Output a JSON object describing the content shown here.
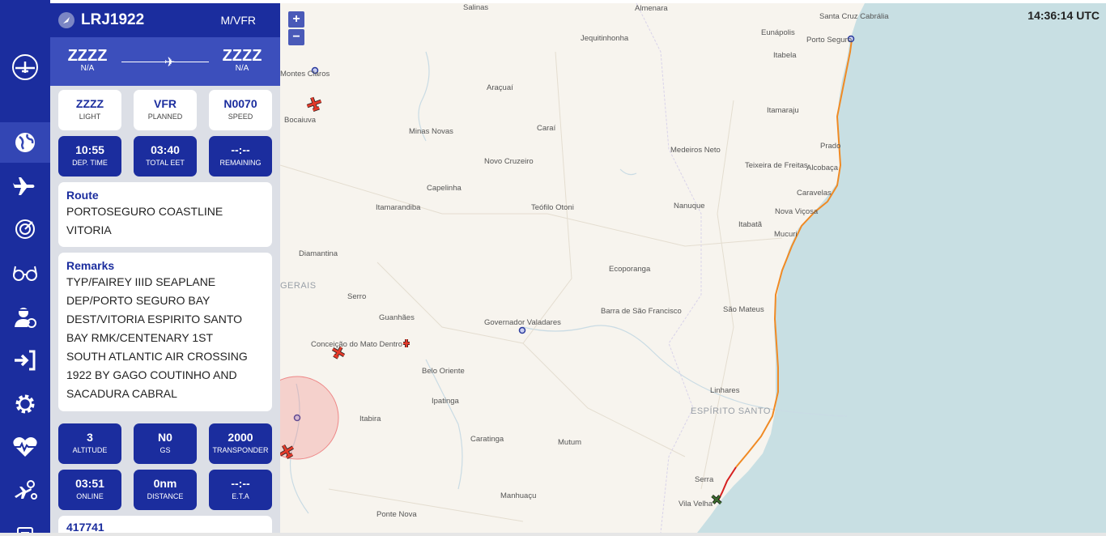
{
  "clock": "14:36:14 UTC",
  "flight": {
    "callsign": "LRJ1922",
    "flight_rules": "M/VFR",
    "departure": {
      "code": "ZZZZ",
      "name": "N/A"
    },
    "arrival": {
      "code": "ZZZZ",
      "name": "N/A"
    },
    "info_tiles": [
      {
        "value": "ZZZZ",
        "label": "LIGHT"
      },
      {
        "value": "VFR",
        "label": "PLANNED"
      },
      {
        "value": "N0070",
        "label": "SPEED"
      }
    ],
    "time_tiles": [
      {
        "value": "10:55",
        "label": "DEP. TIME"
      },
      {
        "value": "03:40",
        "label": "TOTAL EET"
      },
      {
        "value": "--:--",
        "label": "REMAINING"
      }
    ],
    "route": {
      "title": "Route",
      "lines": [
        "PORTOSEGURO COASTLINE",
        "VITORIA"
      ]
    },
    "remarks": {
      "title": "Remarks",
      "lines": [
        "TYP/FAIREY IIID SEAPLANE",
        "DEP/PORTO SEGURO BAY",
        "DEST/VITORIA ESPIRITO SANTO",
        "BAY RMK/CENTENARY 1ST",
        "SOUTH ATLANTIC AIR CROSSING",
        "1922 BY GAGO COUTINHO AND",
        "SACADURA CABRAL"
      ]
    },
    "live_tiles": [
      {
        "value": "3",
        "label": "ALTITUDE"
      },
      {
        "value": "N0",
        "label": "GS"
      },
      {
        "value": "2000",
        "label": "TRANSPONDER"
      }
    ],
    "stat_tiles": [
      {
        "value": "03:51",
        "label": "ONLINE"
      },
      {
        "value": "0nm",
        "label": "DISTANCE"
      },
      {
        "value": "--:--",
        "label": "E.T.A"
      }
    ],
    "pilot_id": "417741"
  },
  "nav": [
    {
      "name": "home-icon",
      "label": "home"
    },
    {
      "name": "globe-icon",
      "label": "map",
      "active": true
    },
    {
      "name": "airplane-icon",
      "label": "flights"
    },
    {
      "name": "radar-icon",
      "label": "controllers"
    },
    {
      "name": "glasses-icon",
      "label": "observers"
    },
    {
      "name": "pilot-icon",
      "label": "pilot"
    },
    {
      "name": "login-icon",
      "label": "login"
    },
    {
      "name": "gear-icon",
      "label": "settings"
    },
    {
      "name": "heartbeat-icon",
      "label": "status"
    },
    {
      "name": "plane-settings-icon",
      "label": "aircraft"
    },
    {
      "name": "document-icon",
      "label": "docs"
    }
  ],
  "map": {
    "zoom_in": "+",
    "zoom_out": "−",
    "cities": [
      "Salinas",
      "Almenara",
      "Santa Cruz Cabrália",
      "Eunápolis",
      "Porto Seguro",
      "Jequitinhonha",
      "Itabela",
      "Montes Claros",
      "Araçuaí",
      "Bocaiuva",
      "Itamaraju",
      "Minas Novas",
      "Caraí",
      "Prado",
      "Medeiros Neto",
      "Novo Cruzeiro",
      "Teixeira de Freitas",
      "Alcobaça",
      "Capelinha",
      "Caravelas",
      "Itamarandiba",
      "Teófilo Otoni",
      "Nanuque",
      "Nova Viçosa",
      "Itabatã",
      "Mucuri",
      "Diamantina",
      "Ecoporanga",
      "Serro",
      "Guanhães",
      "Governador Valadares",
      "Barra de São Francisco",
      "São Mateus",
      "Conceição do Mato Dentro",
      "Belo Oriente",
      "Linhares",
      "Ipatinga",
      "Itabira",
      "Caratinga",
      "Mutum",
      "Serra",
      "Manhuaçu",
      "Vila Velha",
      "Ponte Nova"
    ],
    "regions": [
      "GERAIS",
      "ESPÍRITO SANTO"
    ],
    "colors": {
      "land": "#f7f4ee",
      "sea": "#c8dfe3",
      "route": "#f08a24",
      "route_end": "#d62020",
      "accent": "#1b2d9e"
    }
  }
}
